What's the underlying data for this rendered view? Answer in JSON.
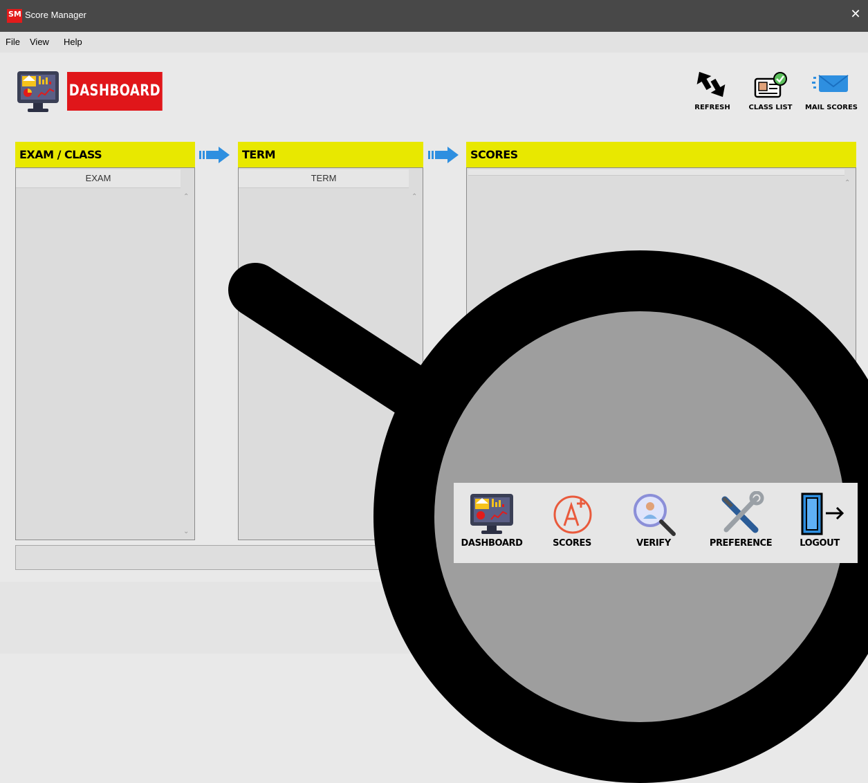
{
  "window": {
    "title": "Score Manager",
    "icon_text": "SM",
    "close_icon": "close-icon"
  },
  "menu": [
    "File",
    "View",
    "Help"
  ],
  "header": {
    "title": "DASHBOARD",
    "icon": "dashboard-monitor-icon"
  },
  "toolbar": [
    {
      "label": "REFRESH",
      "icon": "refresh-icon"
    },
    {
      "label": "CLASS LIST",
      "icon": "id-card-check-icon"
    },
    {
      "label": "MAIL SCORES",
      "icon": "mail-icon"
    }
  ],
  "panels": {
    "exam": {
      "title": "EXAM / CLASS",
      "column": "EXAM"
    },
    "term": {
      "title": "TERM",
      "column": "TERM"
    },
    "scores": {
      "title": "SCORES"
    }
  },
  "nav": [
    {
      "label": "DASHBOARD",
      "icon": "dashboard-monitor-icon"
    },
    {
      "label": "SCORES",
      "icon": "grade-a-plus-icon"
    },
    {
      "label": "VERIFY",
      "icon": "magnifier-user-icon"
    },
    {
      "label": "PREFERENCE",
      "icon": "wrench-screwdriver-icon"
    },
    {
      "label": "LOGOUT",
      "icon": "logout-door-icon"
    }
  ],
  "colors": {
    "accent_yellow": "#e8e800",
    "brand_red": "#e0161a",
    "arrow_blue": "#2e8fe0"
  }
}
